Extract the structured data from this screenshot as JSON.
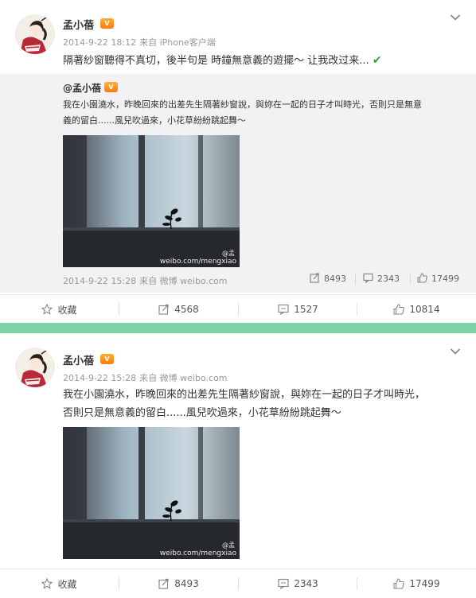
{
  "post1": {
    "author": "孟小蓓",
    "vip_badge": "V",
    "time": "2014-9-22 18:12",
    "source": "来自 iPhone客户端",
    "text": "隔著紗窗聽得不真切，後半句是 時鐘無意義的遊擺～ 让我改过来...",
    "check": "✔",
    "repost": {
      "author": "@孟小蓓",
      "text_line1": "我在小園澆水，昨晚回來的出差先生隔著紗窗說，與妳在一起的日子才叫時光，否則只是無意",
      "text_line2": "義的留白......風兒吹過來，小花草紛紛跳起舞～",
      "watermark": "weibo.com/mengxiao",
      "watermark_handle": "@孟",
      "time": "2014-9-22 15:28",
      "source": "来自 微博 weibo.com",
      "stats": {
        "reposts": "8493",
        "comments": "2343",
        "likes": "17499"
      }
    },
    "actions": {
      "favorite": "收藏",
      "reposts": "4568",
      "comments": "1527",
      "likes": "10814"
    }
  },
  "post2": {
    "author": "孟小蓓",
    "vip_badge": "V",
    "time": "2014-9-22 15:28",
    "source": "来自 微博 weibo.com",
    "text_line1": "我在小園澆水，昨晚回來的出差先生隔著紗窗說，與妳在一起的日子才叫時光，",
    "text_line2": "否則只是無意義的留白......風兒吹過來，小花草紛紛跳起舞～",
    "watermark": "weibo.com/mengxiao",
    "watermark_handle": "@孟",
    "actions": {
      "favorite": "收藏",
      "reposts": "8493",
      "comments": "2343",
      "likes": "17499"
    }
  },
  "colors": {
    "divider": "#7fd2a6",
    "repost_bg": "#f2f2f5",
    "check": "#2ea043",
    "meta": "#999999"
  },
  "icons": [
    "chevron-down-icon",
    "star-icon",
    "repost-icon",
    "comment-icon",
    "like-icon",
    "weibo-logo-icon"
  ]
}
